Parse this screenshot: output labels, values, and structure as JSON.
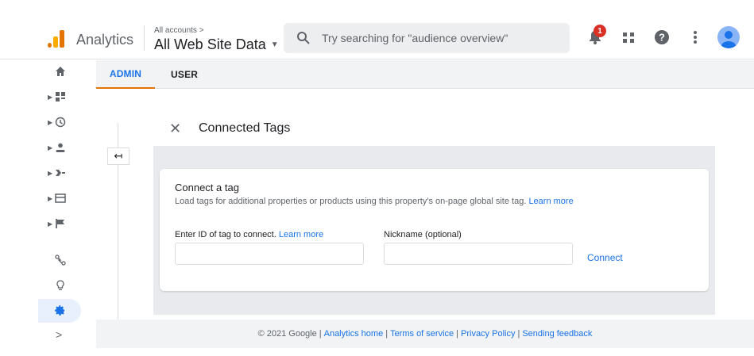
{
  "header": {
    "app_name": "Analytics",
    "account_path": "All accounts >",
    "property_view": "All Web Site Data",
    "search_placeholder": "Try searching for \"audience overview\"",
    "notification_count": "1",
    "icons": [
      "bell-icon",
      "apps-grid-icon",
      "help-icon",
      "more-vert-icon",
      "account-avatar"
    ]
  },
  "leftnav": {
    "items": [
      {
        "name": "home",
        "icon": "home-icon"
      },
      {
        "name": "customization",
        "icon": "dashboard-icon"
      },
      {
        "name": "realtime",
        "icon": "clock-icon"
      },
      {
        "name": "audience",
        "icon": "person-icon"
      },
      {
        "name": "acquisition",
        "icon": "acquisition-icon"
      },
      {
        "name": "behavior",
        "icon": "behavior-icon"
      },
      {
        "name": "conversions",
        "icon": "flag-icon"
      },
      {
        "name": "attribution",
        "icon": "attribution-icon"
      },
      {
        "name": "discover",
        "icon": "lightbulb-icon"
      },
      {
        "name": "admin",
        "icon": "gear-icon"
      }
    ],
    "expand": ">"
  },
  "tabs": {
    "admin": "ADMIN",
    "user": "USER",
    "active": "ADMIN"
  },
  "panel": {
    "title": "Connected Tags",
    "back_icon": "↤",
    "close_icon": "✕"
  },
  "card": {
    "title": "Connect a tag",
    "description": "Load tags for additional properties or products using this property's on-page global site tag.",
    "description_link": "Learn more",
    "id_label": "Enter ID of tag to connect.",
    "id_label_link": "Learn more",
    "id_value": "",
    "nickname_label": "Nickname (optional)",
    "nickname_value": "",
    "connect_label": "Connect"
  },
  "footer": {
    "copyright": "© 2021 Google",
    "links": [
      "Analytics home",
      "Terms of service",
      "Privacy Policy",
      "Sending feedback"
    ]
  },
  "colors": {
    "accent_blue": "#1a73e8",
    "analytics_orange": "#e37400",
    "analytics_yellow": "#f9ab00",
    "notification_red": "#d93025"
  }
}
